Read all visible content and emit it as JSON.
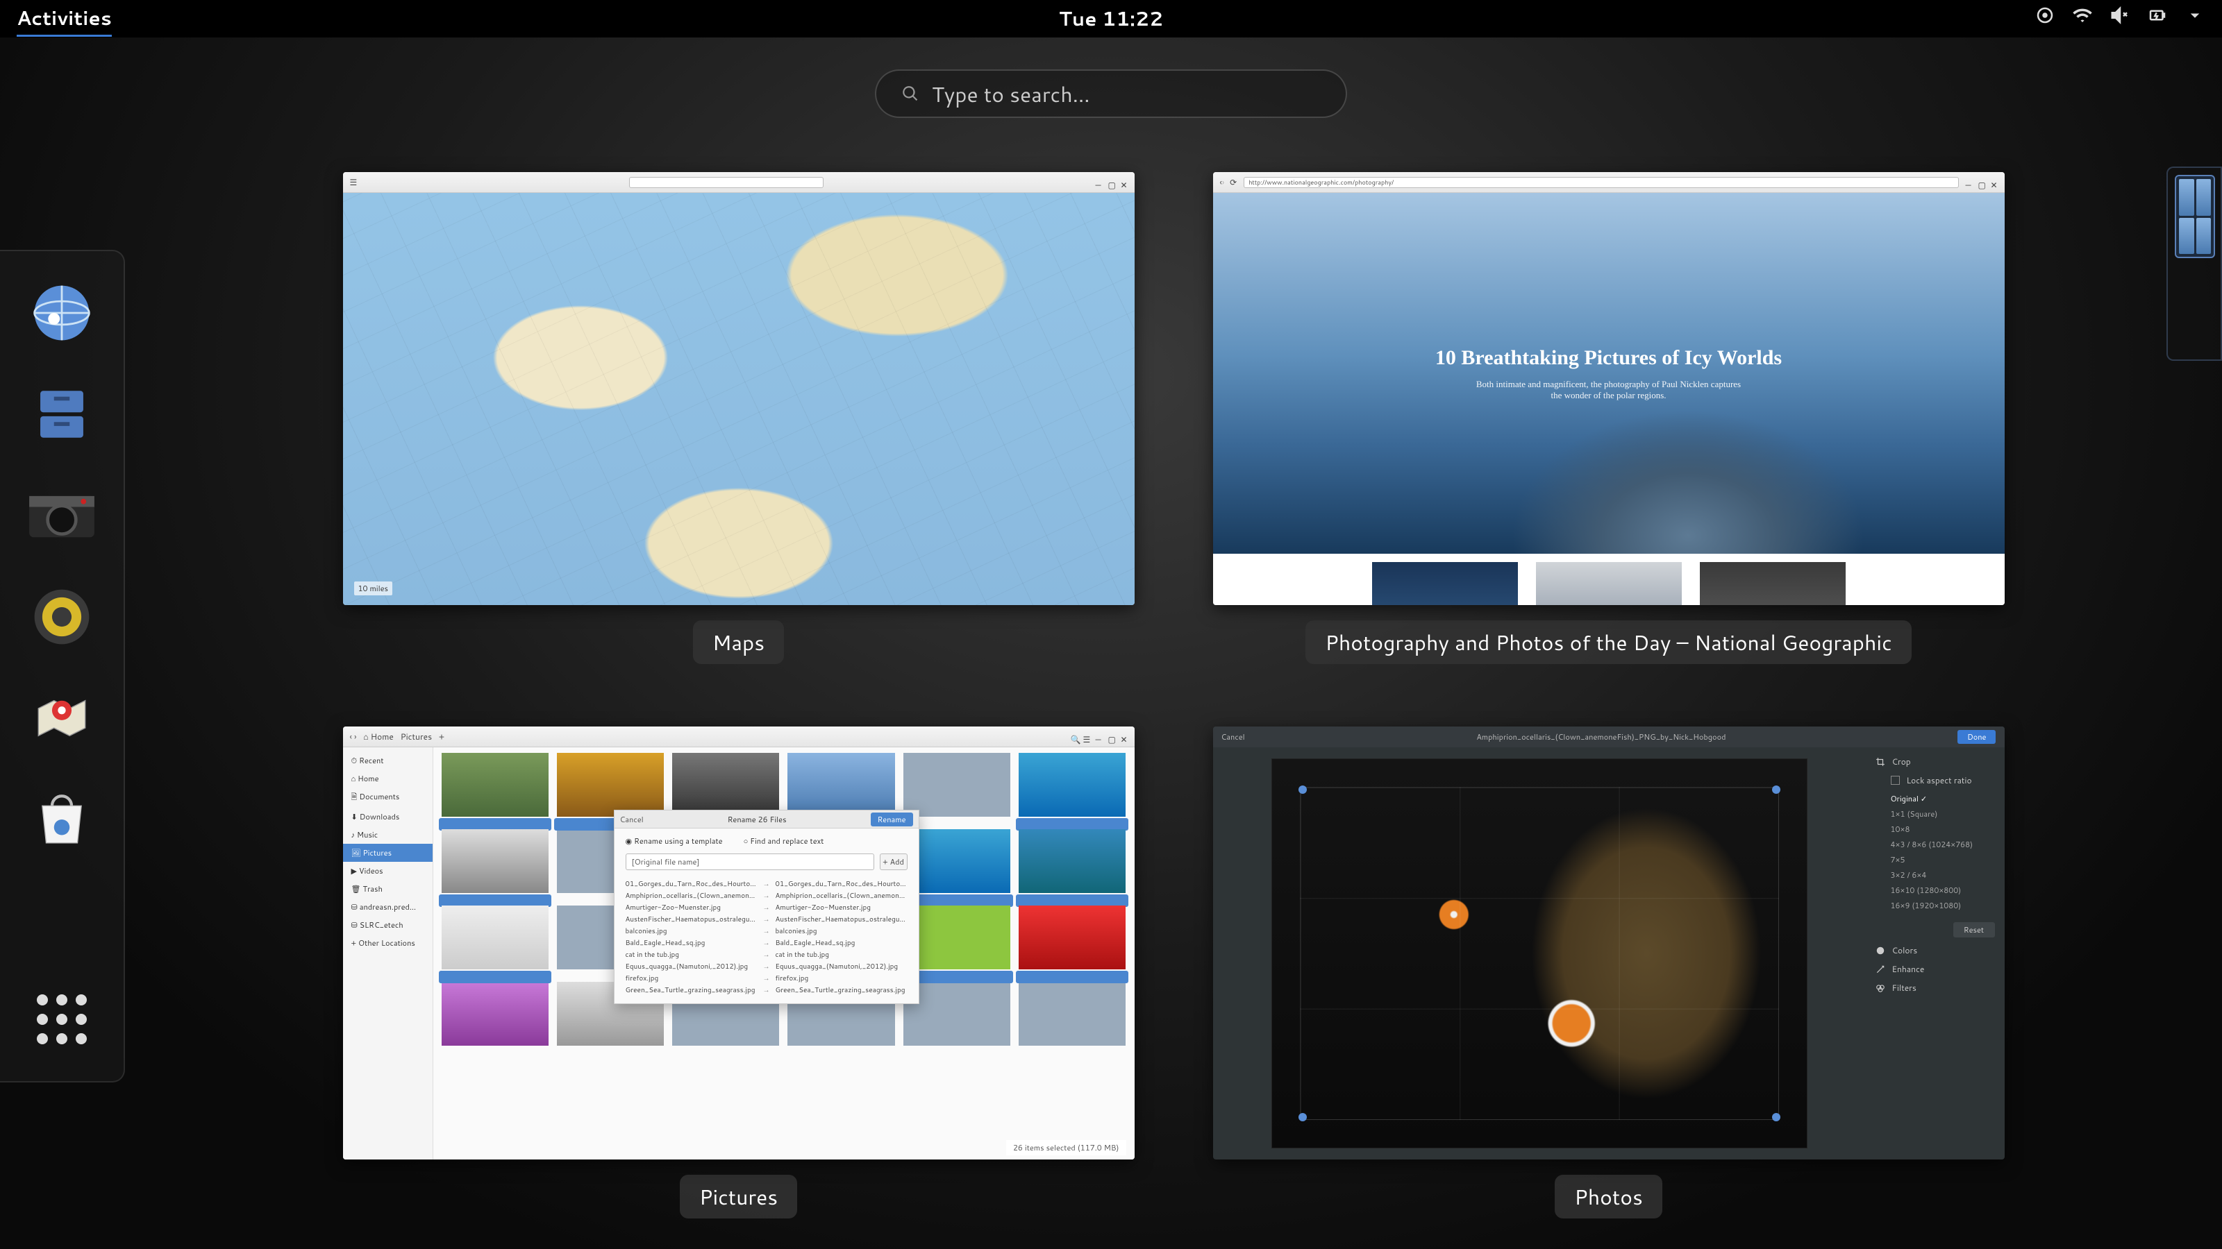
{
  "top_bar": {
    "activities_label": "Activities",
    "clock": "Tue 11:22"
  },
  "search": {
    "placeholder": "Type to search…"
  },
  "dash": {
    "items": [
      {
        "name": "web-browser",
        "label": "Web"
      },
      {
        "name": "files",
        "label": "Files"
      },
      {
        "name": "camera",
        "label": "Camera"
      },
      {
        "name": "music",
        "label": "Music"
      },
      {
        "name": "maps",
        "label": "Maps"
      },
      {
        "name": "software",
        "label": "Software"
      }
    ],
    "show_apps_label": "Show Applications"
  },
  "windows": [
    {
      "title": "Maps",
      "app": "maps",
      "maps": {
        "scale_label": "10 miles"
      }
    },
    {
      "title": "Photography and Photos of the Day – National Geographic",
      "app": "browser",
      "browser": {
        "url": "http://www.nationalgeographic.com/photography/",
        "hero_title": "10 Breathtaking Pictures of Icy Worlds",
        "hero_subtitle": "Both intimate and magnificent, the photography of Paul Nicklen captures the wonder of the polar regions."
      }
    },
    {
      "title": "Pictures",
      "app": "files",
      "files": {
        "path_segments": [
          "Home",
          "Pictures"
        ],
        "sidebar": [
          "Recent",
          "Home",
          "Documents",
          "Downloads",
          "Music",
          "Pictures",
          "Videos",
          "Trash",
          "andreasn.pred…",
          "SLRC_etech",
          "Other Locations"
        ],
        "active_sidebar": "Pictures",
        "statusbar": "26 items selected (117.0 MB)",
        "rename_dialog": {
          "title": "Rename 26 Files",
          "cancel": "Cancel",
          "rename": "Rename",
          "radio_template": "Rename using a template",
          "radio_replace": "Find and replace text",
          "input_value": "[Original file name]",
          "add_button": "+ Add",
          "preview_rows": [
            [
              "01_Gorges_du_Tarn_Roc_des_Hourtous.j…",
              "01_Gorges_du_Tarn_Roc_des_Hourtous.j…"
            ],
            [
              "Amphiprion_ocellaris_(Clown_anemonefis…",
              "Amphiprion_ocellaris_(Clown_anemonefis…"
            ],
            [
              "Amurtiger-Zoo-Muenster.jpg",
              "Amurtiger-Zoo-Muenster.jpg"
            ],
            [
              "AustenFischer_Haematopus_ostralegus_1…",
              "AustenFischer_Haematopus_ostralegus_1…"
            ],
            [
              "balconies.jpg",
              "balconies.jpg"
            ],
            [
              "Bald_Eagle_Head_sq.jpg",
              "Bald_Eagle_Head_sq.jpg"
            ],
            [
              "cat in the tub.jpg",
              "cat in the tub.jpg"
            ],
            [
              "Equus_quagga_(Namutoni,_2012).jpg",
              "Equus_quagga_(Namutoni,_2012).jpg"
            ],
            [
              "firefox.jpg",
              "firefox.jpg"
            ],
            [
              "Green_Sea_Turtle_grazing_seagrass.jpg",
              "Green_Sea_Turtle_grazing_seagrass.jpg"
            ]
          ]
        }
      }
    },
    {
      "title": "Photos",
      "app": "photos",
      "photos": {
        "header_file": "Amphiprion_ocellaris_(Clown_anemoneFish)_PNG_by_Nick_Hobgood",
        "cancel": "Cancel",
        "done": "Done",
        "panel": {
          "crop": "Crop",
          "lock_aspect": "Lock aspect ratio",
          "ratios": [
            "Original ✓",
            "1×1 (Square)",
            "10×8",
            "4×3 / 8×6 (1024×768)",
            "7×5",
            "3×2 / 6×4",
            "16×10 (1280×800)",
            "16×9 (1920×1080)"
          ],
          "reset": "Reset",
          "colors": "Colors",
          "enhance": "Enhance",
          "filters": "Filters"
        }
      }
    }
  ],
  "icon_names": {
    "settings": "settings-gear-icon",
    "wifi": "wifi-icon",
    "volume": "volume-muted-icon",
    "battery": "battery-charging-icon",
    "dropdown": "chevron-down-icon"
  }
}
